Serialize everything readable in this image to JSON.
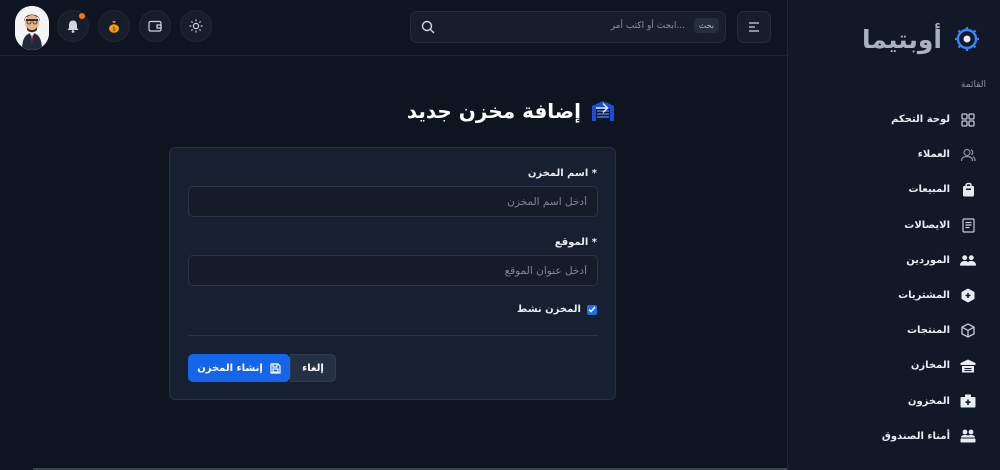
{
  "sidebar": {
    "brand": "أوبتيما",
    "section_title": "القائمة",
    "items": [
      {
        "label": "لوحة التحكم",
        "icon": "grid-icon"
      },
      {
        "label": "العملاء",
        "icon": "users-icon"
      },
      {
        "label": "المبيعات",
        "icon": "shopping-bag-icon"
      },
      {
        "label": "الايصالات",
        "icon": "receipt-icon"
      },
      {
        "label": "الموردين",
        "icon": "suppliers-icon"
      },
      {
        "label": "المشتريات",
        "icon": "package-plus-icon"
      },
      {
        "label": "المنتجات",
        "icon": "box-icon"
      },
      {
        "label": "المخازن",
        "icon": "warehouse-icon"
      },
      {
        "label": "المخزون",
        "icon": "inventory-icon"
      },
      {
        "label": "أمناء الصندوق",
        "icon": "cashiers-icon"
      }
    ]
  },
  "topbar": {
    "search_placeholder": "ابحث أو اكتب أمر...",
    "search_shortcut": "بحث"
  },
  "page": {
    "title": "إضافة مخزن جديد"
  },
  "form": {
    "name_label": "اسم المخزن *",
    "name_placeholder": "أدخل اسم المخزن",
    "location_label": "الموقع *",
    "location_placeholder": "أدخل عنوان الموقع",
    "active_label": "المخزن نشط",
    "active_checked": true,
    "create_button": "إنشاء المخزن",
    "cancel_button": "إلغاء"
  },
  "colors": {
    "accent": "#1565e8",
    "background": "#0f1520",
    "sidebar": "#111827",
    "card": "#172030",
    "notification_dot": "#f97316"
  }
}
